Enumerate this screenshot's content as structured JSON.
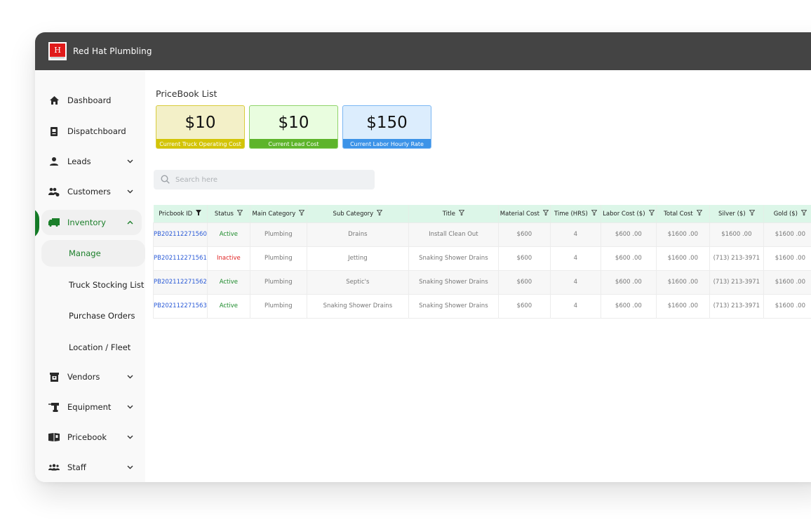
{
  "app": {
    "brand": "Red Hat Plumbling",
    "logo_letter": "H"
  },
  "sidebar": {
    "items": [
      {
        "label": "Dashboard",
        "icon": "home-icon",
        "expandable": false
      },
      {
        "label": "Dispatchboard",
        "icon": "clipboard-icon",
        "expandable": false
      },
      {
        "label": "Leads",
        "icon": "person-icon",
        "expandable": true
      },
      {
        "label": "Customers",
        "icon": "customers-icon",
        "expandable": true
      },
      {
        "label": "Inventory",
        "icon": "truck-icon",
        "expandable": true,
        "expanded": true,
        "active": true
      },
      {
        "label": "Vendors",
        "icon": "store-icon",
        "expandable": true
      },
      {
        "label": "Equipment",
        "icon": "drill-icon",
        "expandable": true
      },
      {
        "label": "Pricebook",
        "icon": "book-icon",
        "expandable": true
      },
      {
        "label": "Staff",
        "icon": "group-icon",
        "expandable": true
      }
    ],
    "inventory_subitems": [
      {
        "label": "Manage",
        "active": true
      },
      {
        "label": "Truck Stocking List"
      },
      {
        "label": "Purchase Orders"
      },
      {
        "label": "Location / Fleet"
      }
    ]
  },
  "main": {
    "title": "PriceBook List",
    "cards": [
      {
        "value": "$10",
        "label": "Current Truck Operating Cost",
        "bg": "#f3f0c8",
        "border": "#d8cc3c",
        "label_bg": "#d3c407"
      },
      {
        "value": "$10",
        "label": "Current Lead Cost",
        "bg": "#e9fddf",
        "border": "#8fd36a",
        "label_bg": "#5db42a"
      },
      {
        "value": "$150",
        "label": "Current Labor Hourly Rate",
        "bg": "#dcedfd",
        "border": "#7bb7f3",
        "label_bg": "#3c93e8"
      }
    ],
    "search": {
      "placeholder": "Search here",
      "value": ""
    },
    "table": {
      "columns": [
        "Pricbook ID",
        "Status",
        "Main Category",
        "Sub Category",
        "Title",
        "Material Cost",
        "Time (HRS)",
        "Labor Cost ($)",
        "Total Cost",
        "Silver  ($)",
        "Gold ($)"
      ],
      "rows": [
        {
          "id": "PB202112271560",
          "status": "Active",
          "main_category": "Plumbing",
          "sub_category": "Drains",
          "title": "Install Clean Out",
          "material_cost": "$600",
          "time": "4",
          "labor_cost": "$600 .00",
          "total_cost": "$1600 .00",
          "silver": "$1600 .00",
          "gold": "$1600 .00"
        },
        {
          "id": "PB202112271561",
          "status": "Inactive",
          "main_category": "Plumbing",
          "sub_category": "Jetting",
          "title": "Snaking Shower Drains",
          "material_cost": "$600",
          "time": "4",
          "labor_cost": "$600 .00",
          "total_cost": "$1600 .00",
          "silver": "(713) 213-3971",
          "gold": "$1600 .00"
        },
        {
          "id": "PB202112271562",
          "status": "Active",
          "main_category": "Plumbing",
          "sub_category": "Septic's",
          "title": "Snaking Shower Drains",
          "material_cost": "$600",
          "time": "4",
          "labor_cost": "$600 .00",
          "total_cost": "$1600 .00",
          "silver": "(713) 213-3971",
          "gold": "$1600 .00"
        },
        {
          "id": "PB202112271563",
          "status": "Active",
          "main_category": "Plumbing",
          "sub_category": "Snaking Shower Drains",
          "title": "Snaking Shower Drains",
          "material_cost": "$600",
          "time": "4",
          "labor_cost": "$600 .00",
          "total_cost": "$1600 .00",
          "silver": "(713) 213-3971",
          "gold": "$1600 .00"
        }
      ]
    }
  }
}
